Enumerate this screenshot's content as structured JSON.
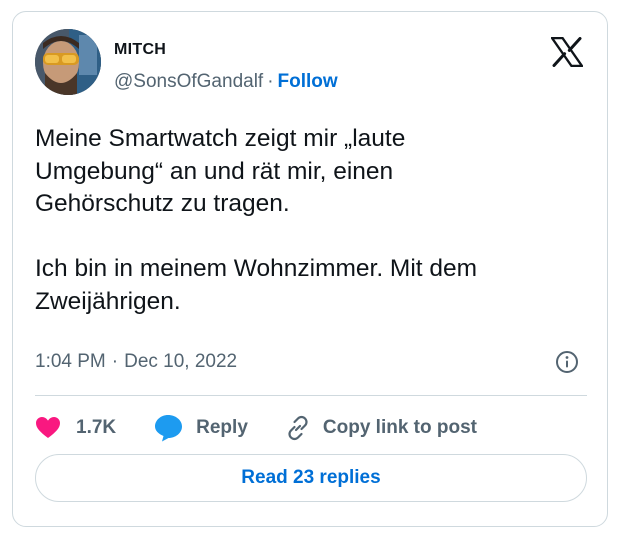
{
  "author": {
    "display_name": "MITCH",
    "badge": " ",
    "handle": "@SonsOfGandalf",
    "separator": "·",
    "follow_label": "Follow"
  },
  "tweet": {
    "text": "Meine Smartwatch zeigt mir „laute\nUmgebung“ an und rät mir, einen\nGehörschutz zu tragen.\n\nIch bin in meinem Wohnzimmer. Mit dem\nZweijährigen.",
    "time": "1:04 PM",
    "separator": "·",
    "date": "Dec 10, 2022"
  },
  "actions": {
    "like_count": "1.7K",
    "reply_label": "Reply",
    "copy_link_label": "Copy link to post"
  },
  "read_replies_label": "Read 23 replies",
  "icons": {
    "brand": "x-logo-icon",
    "info": "info-icon",
    "like": "heart-icon",
    "reply": "speech-bubble-icon",
    "copy": "link-icon"
  },
  "colors": {
    "like": "#f91880",
    "reply": "#1d9bf0",
    "link_text": "#006fd6",
    "secondary_text": "#536471",
    "border": "#cfd9de"
  }
}
